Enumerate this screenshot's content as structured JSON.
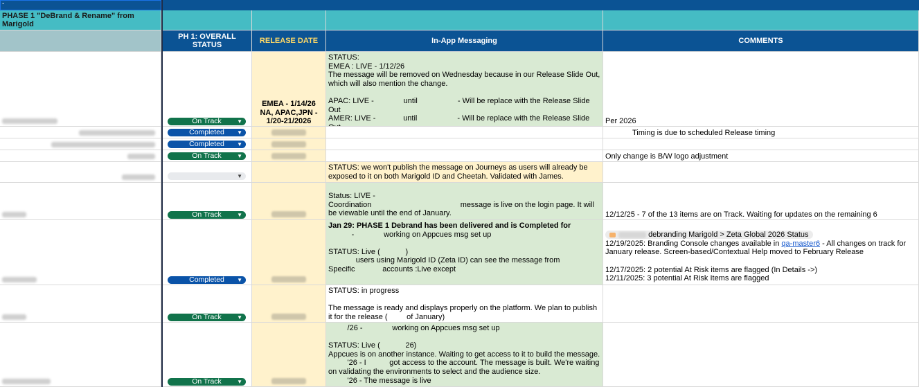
{
  "top": {
    "cell_marker": "-"
  },
  "section_title": "PHASE 1 \"DeBrand & Rename\" from Marigold",
  "headers": {
    "status": "PH 1: OVERALL STATUS",
    "release_date": "RELEASE DATE",
    "messaging": "In-App Messaging",
    "comments": "COMMENTS"
  },
  "colors": {
    "header_blue": "#0b5394",
    "teal": "#45bcc4",
    "on_track": "#11734b",
    "completed": "#0a53a8",
    "cream": "#fff2cc",
    "light_green": "#d9ead3"
  },
  "rows": [
    {
      "status": "On Track",
      "release_date": "EMEA - 1/14/26\nNA, APAC,JPN -\n1/20-21/2026",
      "messaging": "STATUS:\nEMEA : LIVE - 1/12/26\nThe message will be removed on Wednesday because in our Release Slide Out, which will also mention the change.\n\nAPAC: LIVE -              until                   - Will be replace with the Release Slide Out\nAMER: LIVE -             until                   - Will be replace with the Release Slide Out\nJAPAN: LIVE -             until                   - Will be replace with the Release Slide Out",
      "comment": "Per        2026"
    },
    {
      "status": "Completed",
      "release_date": "",
      "messaging": "",
      "comment": "Timing is due to scheduled Release timing"
    },
    {
      "status": "Completed",
      "release_date": "",
      "messaging": "",
      "comment": ""
    },
    {
      "status": "On Track",
      "release_date": "",
      "messaging": "",
      "comment": "Only change is B/W logo adjustment"
    },
    {
      "status": "",
      "release_date": "",
      "messaging": "STATUS: we won't publish the message on Journeys as users will already be exposed to it on both Marigold ID and Cheetah. Validated with James.",
      "comment": ""
    },
    {
      "status": "On Track",
      "release_date": "",
      "messaging": "Status: LIVE -\nCoordination                                          message is live on the login page. It will be viewable until the end of January.",
      "comment": "12/12/25 - 7 of the 13 items are on Track.  Waiting for updates on the remaining 6"
    },
    {
      "status": "Completed",
      "release_date": "",
      "messaging_bold": "Jan 29: PHASE 1 Debrand has been delivered and is Completed for",
      "messaging": "\n           -              working on Appcues msg set up\n\nSTATUS: Live (            )\n             users using Marigold ID (Zeta ID) can see the message from\nSpecific             accounts :Live except",
      "comment_tag": "debranding Marigold > Zeta Global 2026 Status",
      "comment_pre_link": "12/19/2025: Branding Console changes available in ",
      "comment_link": "qa-master6",
      "comment_post_link": " - All changes on track for January release. Screen-based/Contextual Help moved to February Release",
      "comment_lines": [
        "12/17/2025: 2 potential At Risk items are flagged (In Details ->)",
        "12/11/2025: 3 potential At Risk Items are flagged"
      ]
    },
    {
      "status": "On Track",
      "release_date": "",
      "messaging": "STATUS: in progress\n\nThe message is ready and displays properly on the platform. We plan to publish it for the release (         of January)",
      "comment": ""
    },
    {
      "status": "On Track",
      "release_date": "",
      "messaging": "         /26 -              working on Appcues msg set up\n\nSTATUS: Live (            26)\nAppcues is on another instance. Waiting to get access to it to build the message.\n         '26 - I           got access to the account. The message is built. We're waiting on validating the environments to select and the audience size.\n         '26 - The message is live",
      "comment": ""
    }
  ]
}
